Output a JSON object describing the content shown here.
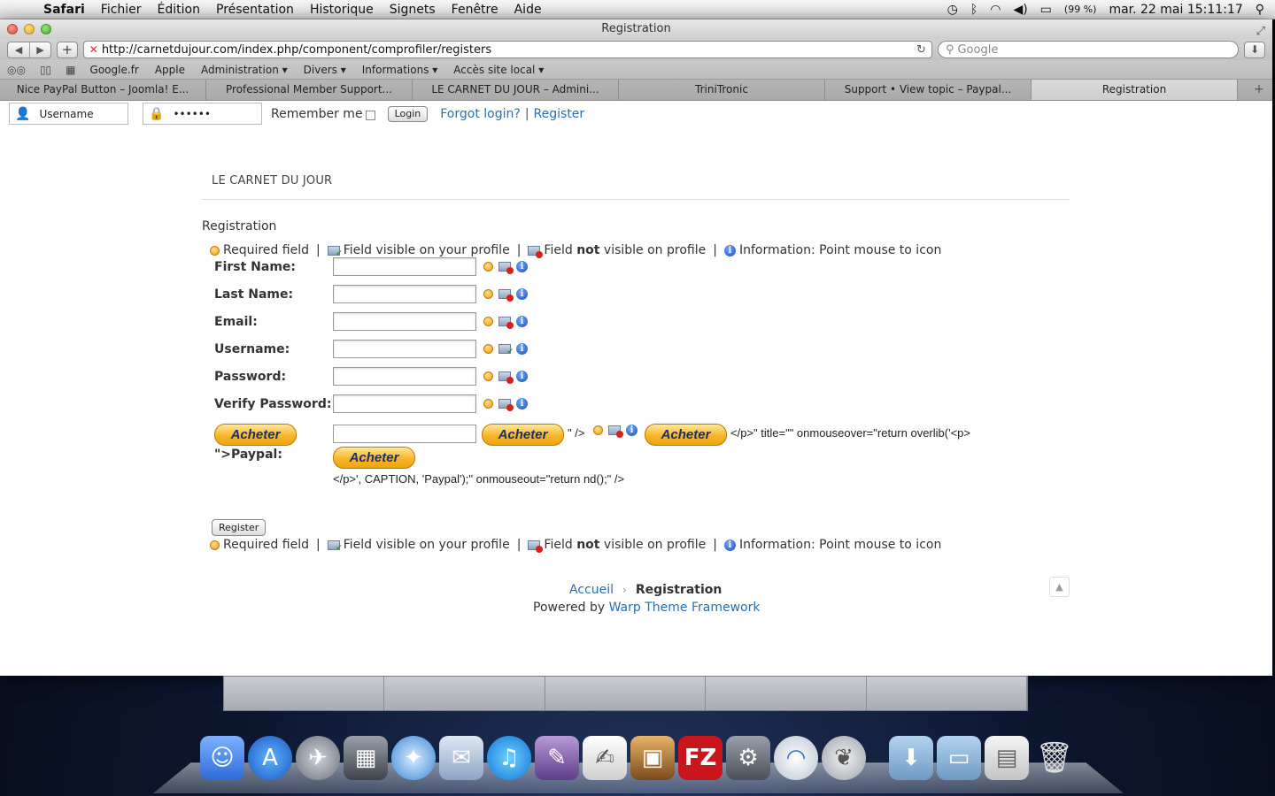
{
  "menubar": {
    "app": "Safari",
    "items": [
      "Fichier",
      "Édition",
      "Présentation",
      "Historique",
      "Signets",
      "Fenêtre",
      "Aide"
    ],
    "battery": "(99 %)",
    "datetime": "mar. 22 mai  15:11:17"
  },
  "window": {
    "title": "Registration",
    "url": "http://carnetdujour.com/index.php/component/comprofiler/registers",
    "search_placeholder": "Google"
  },
  "bookmarks": [
    "Google.fr",
    "Apple",
    "Administration ▾",
    "Divers ▾",
    "Informations ▾",
    "Accès site local ▾"
  ],
  "tabs": [
    {
      "label": "Nice PayPal Button – Joomla! E..."
    },
    {
      "label": "Professional Member Support..."
    },
    {
      "label": "LE CARNET DU JOUR – Admini..."
    },
    {
      "label": "TriniTronic"
    },
    {
      "label": "Support • View topic – Paypal..."
    },
    {
      "label": "Registration"
    }
  ],
  "login": {
    "username_placeholder": "Username",
    "password_value": "••••••",
    "remember_label": "Remember me",
    "login_button": "Login",
    "forgot_link": "Forgot login?",
    "register_link": "Register"
  },
  "site_title": "LE CARNET DU JOUR",
  "page_heading": "Registration",
  "legend": {
    "required": "Required field",
    "visible": "Field visible on your profile",
    "not_visible_pre": "Field ",
    "not_visible_bold": "not",
    "not_visible_post": " visible on profile",
    "info": "Information: Point mouse to icon"
  },
  "fields": [
    {
      "label": "First Name:"
    },
    {
      "label": "Last Name:"
    },
    {
      "label": "Email:"
    },
    {
      "label": "Username:"
    },
    {
      "label": "Password:"
    },
    {
      "label": "Verify Password:"
    }
  ],
  "paypal": {
    "button_label": "Acheter",
    "label": "\">Paypal:",
    "text1": "\" />",
    "text2": "</p>\" title=\"\" onmouseover=\"return overlib('<p>",
    "text3": "</p>', CAPTION, 'Paypal');\" onmouseout=\"return nd();\" />"
  },
  "register_button": "Register",
  "footer": {
    "breadcrumb_home": "Accueil",
    "breadcrumb_current": "Registration",
    "powered_prefix": "Powered by ",
    "powered_link": "Warp Theme Framework"
  },
  "colors": {
    "link": "#2a6fb5",
    "paypal_button": "#f6b62a"
  }
}
